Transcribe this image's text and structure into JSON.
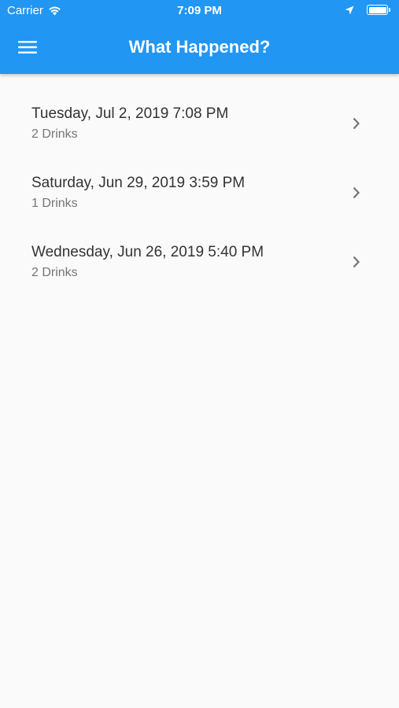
{
  "status_bar": {
    "carrier": "Carrier",
    "time": "7:09 PM"
  },
  "header": {
    "title": "What Happened?",
    "background_color": "#2196f3"
  },
  "entries": [
    {
      "date": "Tuesday, Jul 2, 2019 7:08 PM",
      "drinks": "2 Drinks"
    },
    {
      "date": "Saturday, Jun 29, 2019 3:59 PM",
      "drinks": "1 Drinks"
    },
    {
      "date": "Wednesday, Jun 26, 2019 5:40 PM",
      "drinks": "2 Drinks"
    }
  ],
  "icons": {
    "menu": "hamburger-menu-icon",
    "row_action": "chevron-right-icon",
    "wifi": "wifi-icon",
    "location": "location-arrow-icon",
    "battery": "battery-icon"
  }
}
